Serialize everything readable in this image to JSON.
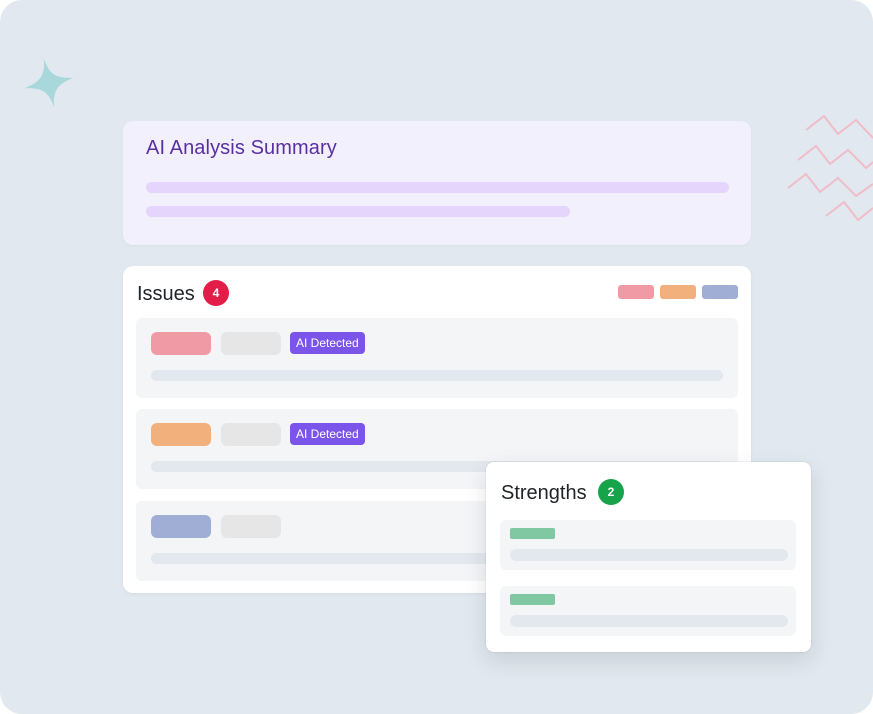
{
  "summary": {
    "title": "AI Analysis Summary"
  },
  "issues": {
    "title": "Issues",
    "count": "4",
    "legend_colors": [
      "#f09aa6",
      "#f2b07c",
      "#a0aed6"
    ],
    "rows": [
      {
        "severity_color": "#f09aa6",
        "tag": "AI Detected"
      },
      {
        "severity_color": "#f2b07c",
        "tag": "AI Detected"
      },
      {
        "severity_color": "#a0aed6",
        "tag": ""
      }
    ]
  },
  "strengths": {
    "title": "Strengths",
    "count": "2",
    "tag_color": "#7fc8a1"
  },
  "colors": {
    "issues_badge": "#e11d48",
    "strengths_badge": "#16a34a",
    "ai_tag": "#7b54ea",
    "sparkle": "#a8d8dc",
    "zigzag": "#f0bcc8"
  }
}
